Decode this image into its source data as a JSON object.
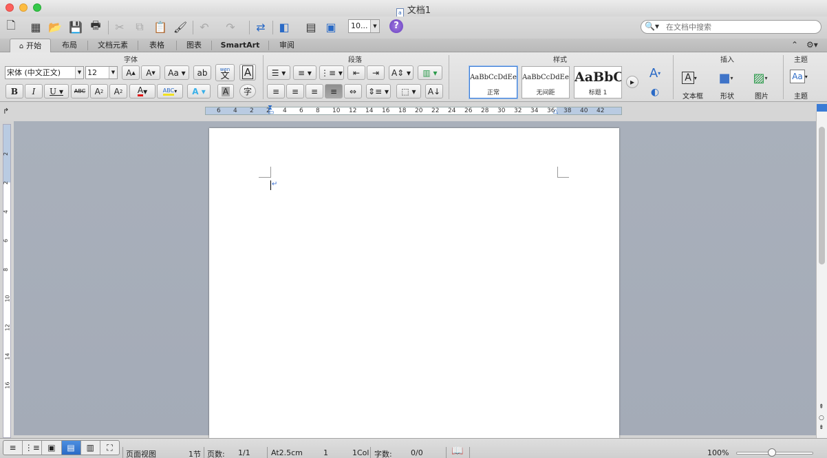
{
  "window": {
    "title": "文档1"
  },
  "toolbar": {
    "zoom_value": "10...",
    "search_placeholder": "在文档中搜索"
  },
  "tabs": [
    {
      "label": "开始"
    },
    {
      "label": "布局"
    },
    {
      "label": "文档元素"
    },
    {
      "label": "表格"
    },
    {
      "label": "图表"
    },
    {
      "label": "SmartArt"
    },
    {
      "label": "审阅"
    }
  ],
  "ribbon": {
    "groups": {
      "font": "字体",
      "paragraph": "段落",
      "styles": "样式",
      "insert": "插入",
      "theme": "主题"
    },
    "font_name": "宋体 (中文正文)",
    "font_size": "12",
    "phonetic_label": "wen 文",
    "styles": [
      {
        "sample": "AaBbCcDdEe",
        "name": "正常"
      },
      {
        "sample": "AaBbCcDdEe",
        "name": "无间距"
      },
      {
        "sample": "AaBbC",
        "name": "标题 1"
      }
    ],
    "insert_items": [
      {
        "label": "文本框"
      },
      {
        "label": "形状"
      },
      {
        "label": "图片"
      }
    ],
    "theme_label": "主题"
  },
  "ruler": {
    "h_numbers": [
      "6",
      "4",
      "2",
      "2",
      "4",
      "6",
      "8",
      "10",
      "12",
      "14",
      "16",
      "18",
      "20",
      "22",
      "24",
      "26",
      "28",
      "30",
      "32",
      "34",
      "36",
      "38",
      "40",
      "42"
    ],
    "v_numbers": [
      "2",
      "2",
      "4",
      "6",
      "8",
      "10",
      "12",
      "14",
      "16"
    ]
  },
  "status": {
    "view_name": "页面视图",
    "section": "1节",
    "pages_label": "页数:",
    "pages_value": "1/1",
    "at": "At2.5cm",
    "line": "1",
    "col": "1Col",
    "words_label": "字数:",
    "words_value": "0/0",
    "zoom": "100%"
  },
  "colors": {
    "active_view": "#3a7bd5",
    "page": "#ffffff",
    "workspace": "#a8afba"
  }
}
